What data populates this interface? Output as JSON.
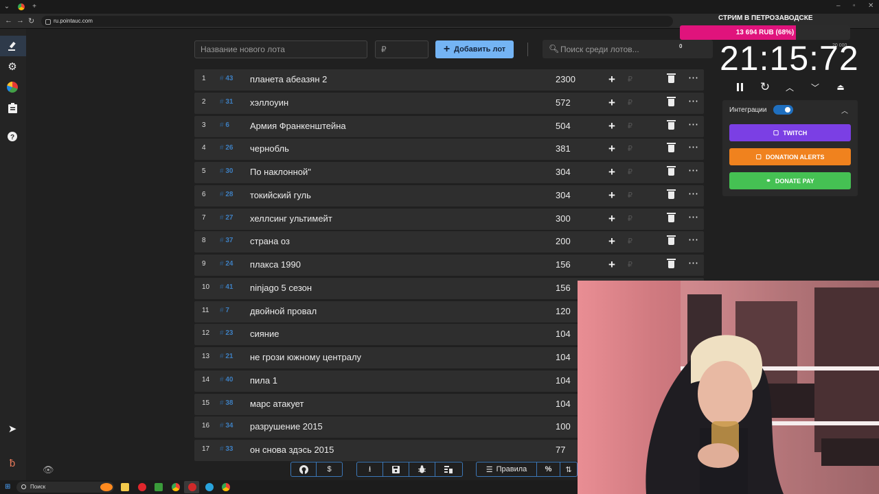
{
  "browser": {
    "url": "ru.pointauc.com"
  },
  "new_lot": {
    "name_placeholder": "Название нового лота",
    "price_placeholder": "₽",
    "add_label": "Добавить лот"
  },
  "search": {
    "placeholder": "Поиск среди лотов...",
    "count": "0"
  },
  "lots": [
    {
      "idx": "1",
      "id": "43",
      "name": "планета абеазян 2",
      "amount": "2300"
    },
    {
      "idx": "2",
      "id": "31",
      "name": "хэллоуин",
      "amount": "572"
    },
    {
      "idx": "3",
      "id": "6",
      "name": "Армия Франкенштейна",
      "amount": "504"
    },
    {
      "idx": "4",
      "id": "26",
      "name": "чернобль",
      "amount": "381"
    },
    {
      "idx": "5",
      "id": "30",
      "name": "По наклонной\"",
      "amount": "304"
    },
    {
      "idx": "6",
      "id": "28",
      "name": "токийский гуль",
      "amount": "304"
    },
    {
      "idx": "7",
      "id": "27",
      "name": "хеллсинг ультимейт",
      "amount": "300"
    },
    {
      "idx": "8",
      "id": "37",
      "name": "страна оз",
      "amount": "200"
    },
    {
      "idx": "9",
      "id": "24",
      "name": "плакса 1990",
      "amount": "156"
    },
    {
      "idx": "10",
      "id": "41",
      "name": "ninjago 5 сезон",
      "amount": "156"
    },
    {
      "idx": "11",
      "id": "7",
      "name": " двойной провал",
      "amount": "120"
    },
    {
      "idx": "12",
      "id": "23",
      "name": "сияние",
      "amount": "104"
    },
    {
      "idx": "13",
      "id": "21",
      "name": "не грози южному централу",
      "amount": "104"
    },
    {
      "idx": "14",
      "id": "40",
      "name": "пила 1",
      "amount": "104"
    },
    {
      "idx": "15",
      "id": "38",
      "name": "марс атакует",
      "amount": "104"
    },
    {
      "idx": "16",
      "id": "34",
      "name": "разрушение 2015",
      "amount": "100"
    },
    {
      "idx": "17",
      "id": "33",
      "name": "он снова здэсь 2015",
      "amount": "77"
    }
  ],
  "lot_actions": {
    "plus": "+",
    "rub": "₽"
  },
  "toolbar": {
    "rules_label": "Правила",
    "percent_label": "%",
    "dollar_label": "$"
  },
  "goal": {
    "title": "СТРИМ В ПЕТРОЗАВОДСКЕ",
    "text": "13 694 RUB (68%)",
    "percent": 68,
    "max": "20 000"
  },
  "timer": {
    "value": "21:15:72"
  },
  "integrations": {
    "label": "Интеграции",
    "enabled": true,
    "buttons": [
      {
        "label": "TWITCH",
        "color": "#7b3fe4"
      },
      {
        "label": "DONATION ALERTS",
        "color": "#f0821e"
      },
      {
        "label": "DONATE PAY",
        "color": "#45c153"
      }
    ]
  },
  "taskbar": {
    "search_label": "Поиск"
  },
  "colors": {
    "accent": "#74b4f4",
    "goal": "#e0137c",
    "hash": "#3e7fc0"
  }
}
